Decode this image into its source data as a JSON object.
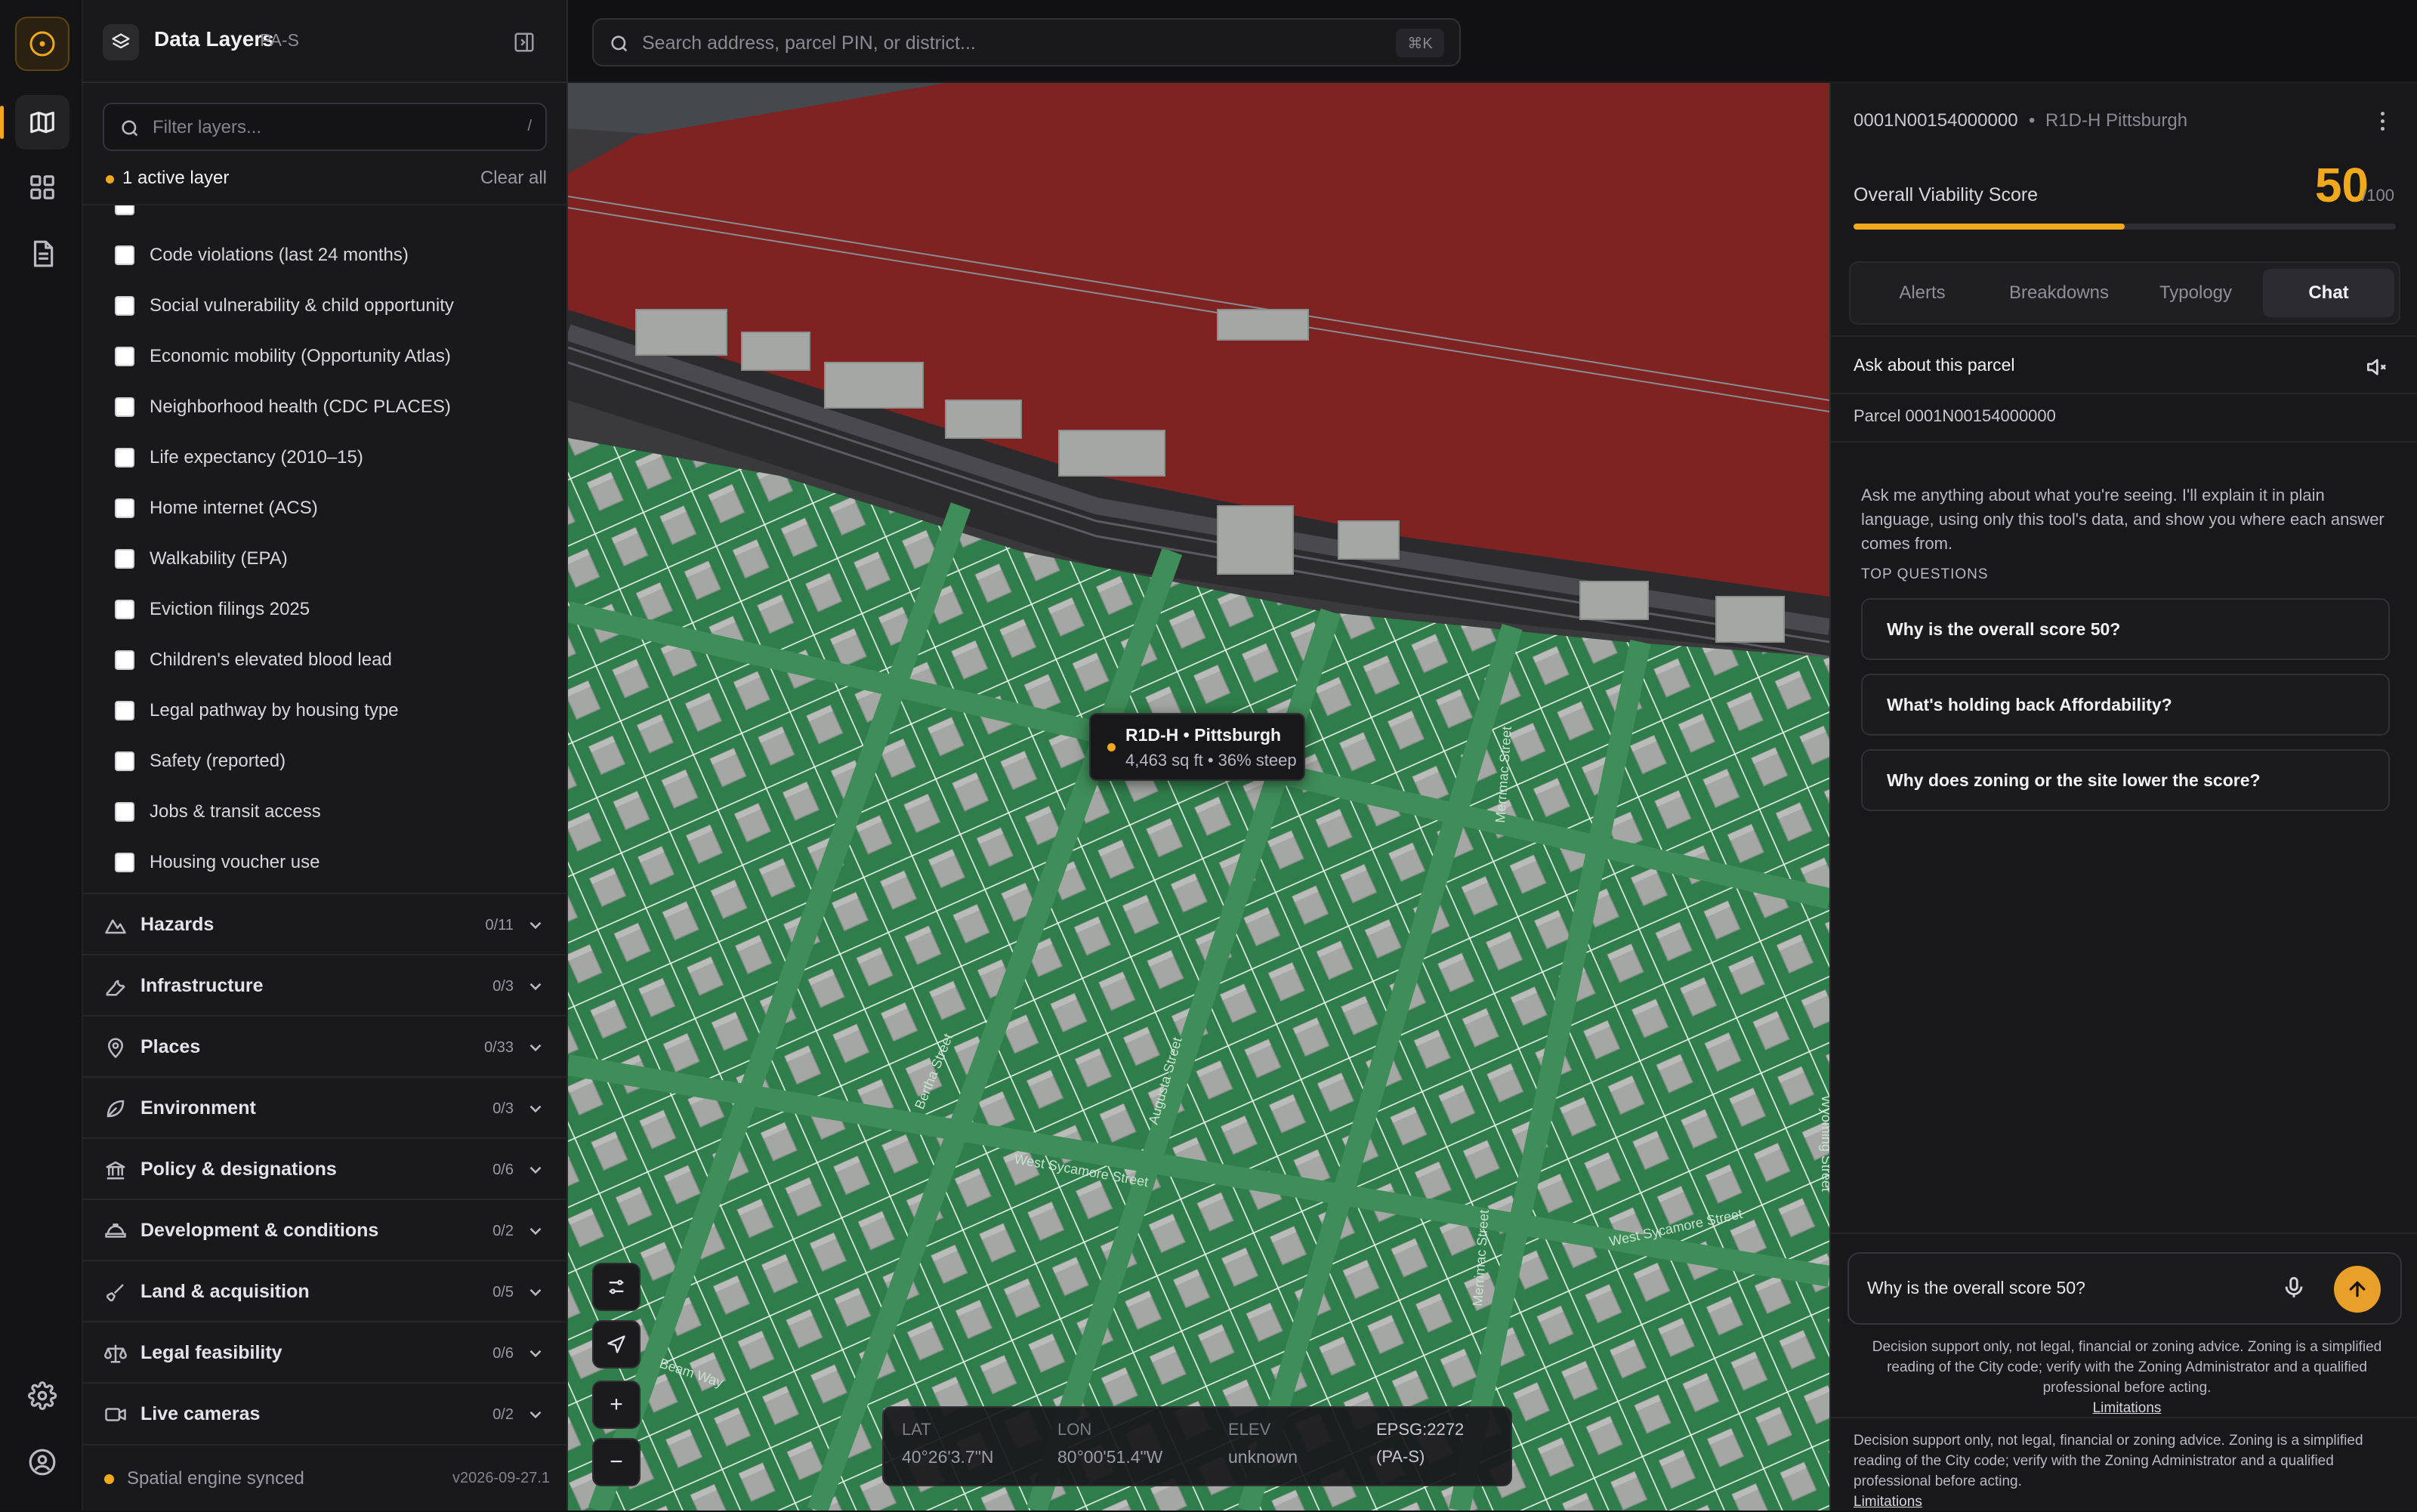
{
  "panel": {
    "title": "Data Layers",
    "region": "PA-S",
    "filter_placeholder": "Filter layers...",
    "filter_shortcut": "/",
    "active_count": "1 active layer",
    "clear_all": "Clear all",
    "layers": [
      "Code violations (last 24 months)",
      "Social vulnerability & child opportunity",
      "Economic mobility (Opportunity Atlas)",
      "Neighborhood health (CDC PLACES)",
      "Life expectancy (2010–15)",
      "Home internet (ACS)",
      "Walkability (EPA)",
      "Eviction filings 2025",
      "Children's elevated blood lead",
      "Legal pathway by housing type",
      "Safety (reported)",
      "Jobs & transit access",
      "Housing voucher use"
    ],
    "categories": [
      {
        "name": "Hazards",
        "count": "0/11",
        "icon": "mountain-icon"
      },
      {
        "name": "Infrastructure",
        "count": "0/3",
        "icon": "wrench-icon"
      },
      {
        "name": "Places",
        "count": "0/33",
        "icon": "map-pin-icon"
      },
      {
        "name": "Environment",
        "count": "0/3",
        "icon": "leaf-icon"
      },
      {
        "name": "Policy & designations",
        "count": "0/6",
        "icon": "landmark-icon"
      },
      {
        "name": "Development & conditions",
        "count": "0/2",
        "icon": "hard-hat-icon"
      },
      {
        "name": "Land & acquisition",
        "count": "0/5",
        "icon": "shovel-icon"
      },
      {
        "name": "Legal feasibility",
        "count": "0/6",
        "icon": "scale-icon"
      },
      {
        "name": "Live cameras",
        "count": "0/2",
        "icon": "video-camera-icon"
      }
    ],
    "status": "Spatial engine synced",
    "version": "v2026-09-27.1"
  },
  "search": {
    "placeholder": "Search address, parcel PIN, or district...",
    "shortcut": "⌘K"
  },
  "map": {
    "tooltip_title": "R1D-H • Pittsburgh",
    "tooltip_detail": "4,463 sq ft • 36% steep",
    "streets": [
      "West Sycamore Street",
      "West Sycamore Street",
      "Merrimac Street",
      "Merrimac Street",
      "Bertha Street",
      "Augusta Street",
      "Beam Way",
      "Wyoming Street"
    ],
    "controls": {
      "zoom_in": "+",
      "zoom_out": "−"
    },
    "coords": {
      "lat_label": "LAT",
      "lat": "40°26'3.7\"N",
      "lon_label": "LON",
      "lon": "80°00'51.4\"W",
      "elev_label": "ELEV",
      "elev": "unknown",
      "epsg_label": "EPSG:2272",
      "epsg": "(PA-S)"
    },
    "colors": {
      "zone_red": "#7e2322",
      "zone_green": "#2f7d4a",
      "road": "#3c3c40",
      "building": "#a4a7a4"
    }
  },
  "detail": {
    "parcel_id": "0001N00154000000",
    "separator": "•",
    "zoning": "R1D-H Pittsburgh",
    "score_label": "Overall Viability Score",
    "score": "50",
    "score_max": "/100",
    "score_value": 50,
    "tabs": [
      "Alerts",
      "Breakdowns",
      "Typology",
      "Chat"
    ],
    "active_tab": "Chat",
    "ask_title": "Ask about this parcel",
    "parcel_line": "Parcel 0001N00154000000",
    "intro": "Ask me anything about what you're seeing. I'll explain it in plain language, using only this tool's data, and show you where each answer comes from.",
    "top_questions_label": "TOP QUESTIONS",
    "questions": [
      "Why is the overall score 50?",
      "What's holding back Affordability?",
      "Why does zoning or the site lower the score?"
    ],
    "input_value": "Why is the overall score 50?",
    "disclaimer": "Decision support only, not legal, financial or zoning advice. Zoning is a simplified reading of the City code; verify with the Zoning Administrator and a qualified professional before acting.",
    "limitations": "Limitations"
  },
  "accent": "#f0a81c"
}
